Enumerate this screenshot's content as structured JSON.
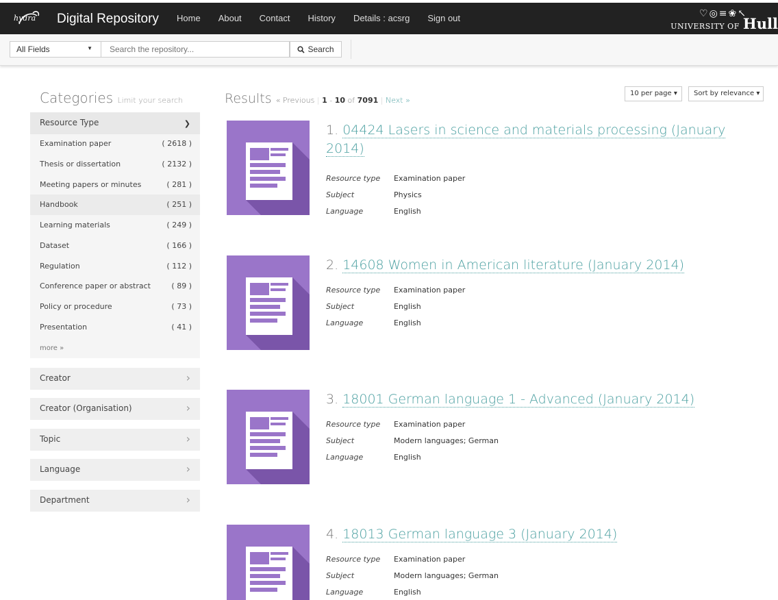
{
  "navbar": {
    "logo_text": "hydra",
    "brand": "Digital Repository",
    "links": [
      "Home",
      "About",
      "Contact",
      "History",
      "Details : acsrg",
      "Sign out"
    ],
    "university": {
      "crest": "♡◎≡❀↖",
      "small": "UNIVERSITY OF",
      "big": "Hull"
    }
  },
  "search": {
    "field": "All Fields",
    "placeholder": "Search the repository...",
    "button": "Search"
  },
  "sidebar": {
    "title": "Categories",
    "subtitle": "Limit your search",
    "resource_type": {
      "label": "Resource Type",
      "items": [
        {
          "label": "Examination paper",
          "count": "( 2618 )"
        },
        {
          "label": "Thesis or dissertation",
          "count": "( 2132 )"
        },
        {
          "label": "Meeting papers or minutes",
          "count": "( 281 )"
        },
        {
          "label": "Handbook",
          "count": "( 251 )"
        },
        {
          "label": "Learning materials",
          "count": "( 249 )"
        },
        {
          "label": "Dataset",
          "count": "( 166 )"
        },
        {
          "label": "Regulation",
          "count": "( 112 )"
        },
        {
          "label": "Conference paper or abstract",
          "count": "( 89 )"
        },
        {
          "label": "Policy or procedure",
          "count": "( 73 )"
        },
        {
          "label": "Presentation",
          "count": "( 41 )"
        }
      ],
      "more": "more »"
    },
    "facets": [
      "Creator",
      "Creator (Organisation)",
      "Topic",
      "Language",
      "Department"
    ]
  },
  "results": {
    "title": "Results",
    "previous": "« Previous",
    "range_start": "1",
    "range_sep": " - ",
    "range_end": "10",
    "of": "of",
    "total": "7091",
    "next": "Next »",
    "per_page": "10 per page",
    "sort": "Sort by relevance",
    "meta_labels": {
      "type": "Resource type",
      "subject": "Subject",
      "language": "Language"
    },
    "items": [
      {
        "num": "1.",
        "title": "04424 Lasers in science and materials processing (January 2014)",
        "type": "Examination paper",
        "subject": "Physics",
        "language": "English"
      },
      {
        "num": "2.",
        "title": "14608 Women in American literature (January 2014)",
        "type": "Examination paper",
        "subject": "English",
        "language": "English"
      },
      {
        "num": "3.",
        "title": "18001 German language 1 - Advanced (January 2014)",
        "type": "Examination paper",
        "subject": "Modern languages; German",
        "language": "English"
      },
      {
        "num": "4.",
        "title": "18013 German language 3 (January 2014)",
        "type": "Examination paper",
        "subject": "Modern languages; German",
        "language": "English"
      }
    ]
  },
  "colors": {
    "navbar": "#222222",
    "link": "#4a9fa0",
    "thumb": "#9a75c9",
    "thumb_shadow": "#7a55a9"
  },
  "icons": [
    "search-icon",
    "document-icon",
    "chevron-down-icon",
    "chevron-right-icon",
    "caret-down-icon"
  ]
}
